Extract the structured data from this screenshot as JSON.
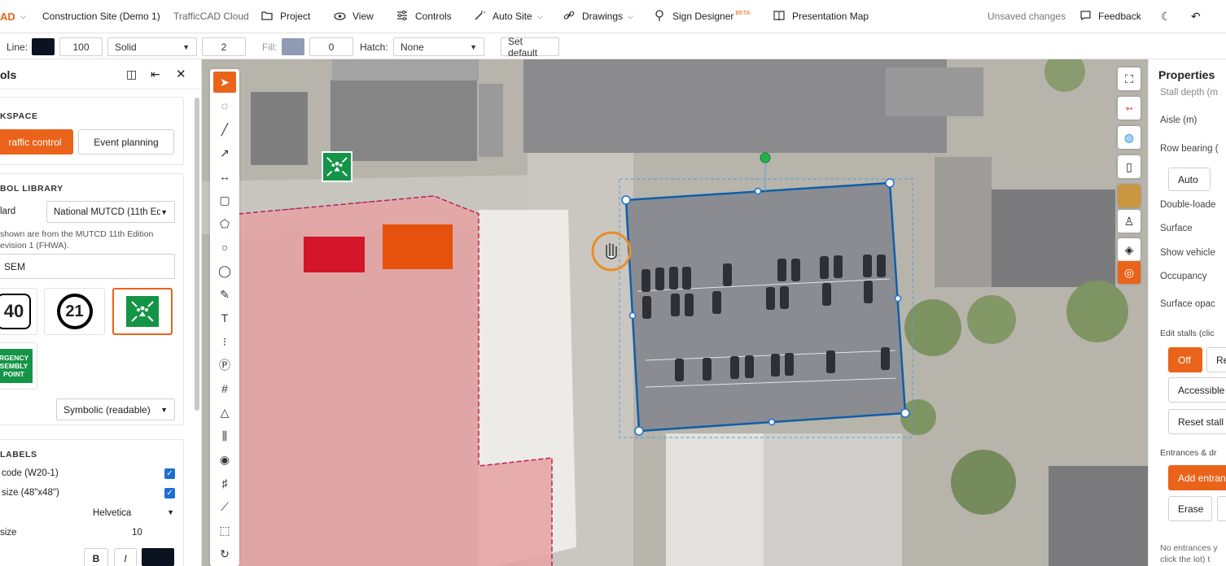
{
  "app": {
    "logo_text": "AD",
    "project_name": "Construction Site (Demo 1)",
    "brand": "TrafficCAD Cloud",
    "menu": [
      {
        "label": "Project",
        "icon": "folder-icon"
      },
      {
        "label": "View",
        "icon": "eye-icon"
      },
      {
        "label": "Controls",
        "icon": "sliders-icon"
      },
      {
        "label": "Auto Site",
        "icon": "magic-wand-icon"
      },
      {
        "label": "Drawings",
        "icon": "link-icon"
      },
      {
        "label": "Sign Designer",
        "icon": "sign-icon",
        "badge": "BETA"
      },
      {
        "label": "Presentation Map",
        "icon": "book-icon"
      }
    ],
    "status": "Unsaved changes",
    "feedback": "Feedback",
    "accent": "#e9631a"
  },
  "style_bar": {
    "line_label": "Line:",
    "line_color": "#0b1320",
    "line_width": "100",
    "line_style": "Solid",
    "line_value2": "2",
    "fill_label": "Fill:",
    "fill_color": "#8f9bb3",
    "fill_value": "0",
    "hatch_label": "Hatch:",
    "hatch_value": "None",
    "set_default": "Set default"
  },
  "tools_panel": {
    "title": "ols",
    "workspace_heading": "KSPACE",
    "workspace_buttons": [
      "raffic control",
      "Event planning"
    ],
    "symbol_heading": "BOL LIBRARY",
    "standard_label": "lard",
    "standard_value": "National MUTCD (11th Edi",
    "note_line1": "shown are from the MUTCD 11th Edition",
    "note_line2": "evision 1 (FHWA).",
    "search_value": "SEM",
    "symbols": [
      "40",
      "21",
      "assembly-point",
      "RGENCY SEMBLY POINT"
    ],
    "render_mode": "Symbolic (readable)",
    "labels_heading": "LABELS",
    "label_rows": [
      {
        "label": "code (W20-1)",
        "checked": true
      },
      {
        "label": "size (48\"x48\")",
        "checked": true
      }
    ],
    "font_value": "Helvetica",
    "size_label": "size",
    "size_value": "10",
    "bold": "B",
    "italic": "I",
    "text_color": "#0b1320"
  },
  "properties": {
    "title": "Properties",
    "rows": [
      "Stall depth (m",
      "Aisle (m)",
      "Row bearing (",
      "Auto",
      "Double-loade",
      "Surface",
      "Show vehicle",
      "Occupancy",
      "Surface opac",
      "Edit stalls (clic",
      "Off",
      "Re",
      "Accessible",
      "Reset stall",
      "Entrances & dr",
      "Add entran",
      "Erase",
      "No entrances y",
      "click the lot) t"
    ]
  }
}
